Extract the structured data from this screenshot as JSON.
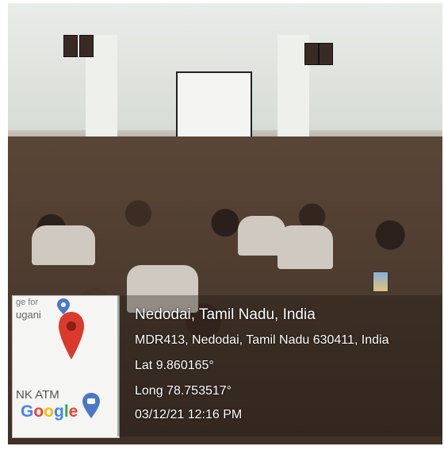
{
  "map_thumbnail": {
    "place_label_partial": "ge for",
    "town_label_partial": "ugani",
    "atm_label_partial": "NK ATM",
    "logo_text": "Google",
    "logo_colors": [
      "#4285F4",
      "#EA4335",
      "#FBBC05",
      "#4285F4",
      "#34A853",
      "#EA4335"
    ]
  },
  "geotag": {
    "place": "Nedodai, Tamil Nadu, India",
    "address": "MDR413, Nedodai, Tamil Nadu 630411, India",
    "latitude": "Lat 9.860165°",
    "longitude": "Long 78.753517°",
    "timestamp": "03/12/21 12:16 PM"
  },
  "accent_colors": {
    "pin_red": "#d93a2b",
    "overlay_text": "#ffffff"
  },
  "icons": [
    "location-pin-icon",
    "map-pin-small-icon",
    "chat-bubble-icon"
  ]
}
